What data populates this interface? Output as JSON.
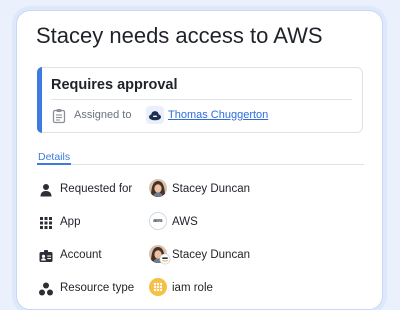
{
  "title": "Stacey needs access to AWS",
  "approval": {
    "heading": "Requires approval",
    "assigned_label": "Assigned to",
    "assignee_name": "Thomas Chuggerton",
    "accent_color": "#3d7be0"
  },
  "tabs": {
    "details_label": "Details"
  },
  "details": [
    {
      "label": "Requested for",
      "icon": "person-icon",
      "value": "Stacey Duncan",
      "value_icon": "user-avatar"
    },
    {
      "label": "App",
      "icon": "grid-icon",
      "value": "AWS",
      "value_icon": "aws-logo"
    },
    {
      "label": "Account",
      "icon": "badge-icon",
      "value": "Stacey Duncan",
      "value_icon": "user-avatar-aws"
    },
    {
      "label": "Resource type",
      "icon": "hierarchy-icon",
      "value": "iam role",
      "value_icon": "iam-role-icon"
    }
  ],
  "aws_logo_text": "aws",
  "colors": {
    "background": "#eaf1fd",
    "text": "#1f2329",
    "link": "#2d6cdf",
    "iam": "#f6c046"
  }
}
